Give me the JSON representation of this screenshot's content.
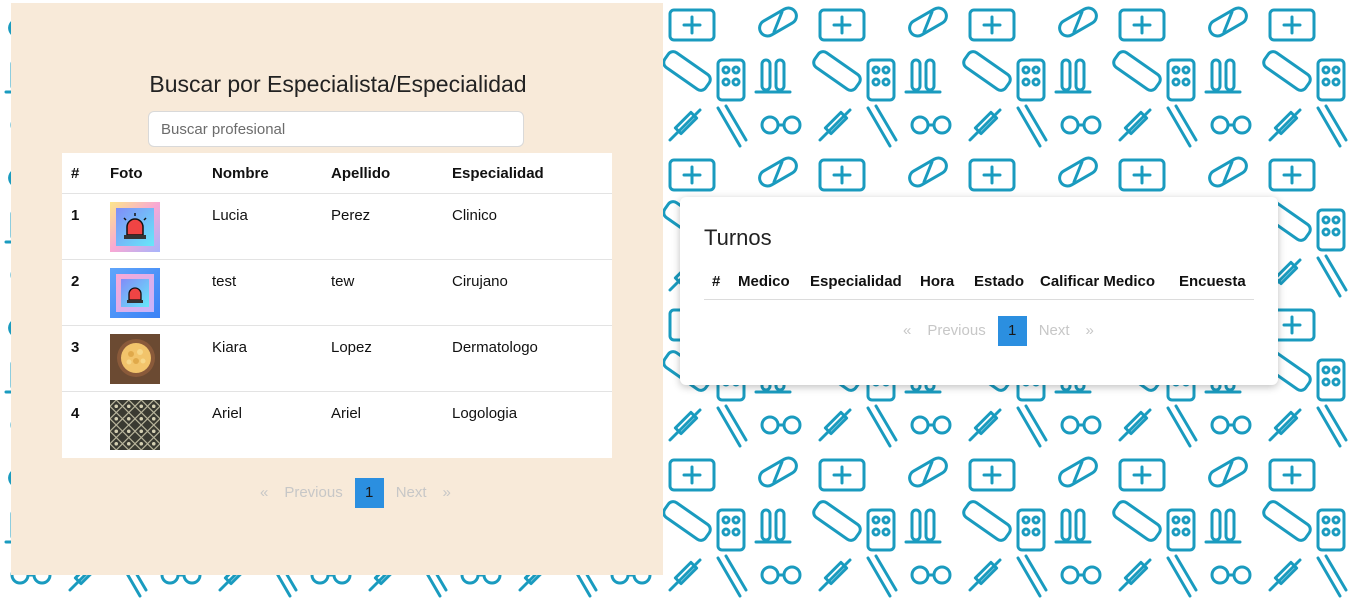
{
  "search": {
    "title": "Buscar por Especialista/Especialidad",
    "placeholder": "Buscar profesional",
    "value": ""
  },
  "professionals_table": {
    "headers": [
      "#",
      "Foto",
      "Nombre",
      "Apellido",
      "Especialidad"
    ],
    "rows": [
      {
        "num": "1",
        "photo": "siren-image-yellow",
        "nombre": "Lucia",
        "apellido": "Perez",
        "especialidad": "Clinico"
      },
      {
        "num": "2",
        "photo": "siren-image-blue",
        "nombre": "test",
        "apellido": "tew",
        "especialidad": "Cirujano"
      },
      {
        "num": "3",
        "photo": "food-bowl-image",
        "nombre": "Kiara",
        "apellido": "Lopez",
        "especialidad": "Dermatologo"
      },
      {
        "num": "4",
        "photo": "pattern-tile-image",
        "nombre": "Ariel",
        "apellido": "Ariel",
        "especialidad": "Logologia"
      }
    ]
  },
  "pagination_left": {
    "first": "«",
    "previous": "Previous",
    "current": "1",
    "next": "Next",
    "last": "»"
  },
  "turnos": {
    "title": "Turnos",
    "headers": [
      "#",
      "Medico",
      "Especialidad",
      "Hora",
      "Estado",
      "Calificar Medico",
      "Encuesta"
    ]
  },
  "pagination_right": {
    "first": "«",
    "previous": "Previous",
    "current": "1",
    "next": "Next",
    "last": "»"
  },
  "colors": {
    "panel_bg": "#f8ead9",
    "pattern_stroke": "#1a9bbf",
    "page_active": "#2b8fe0"
  }
}
